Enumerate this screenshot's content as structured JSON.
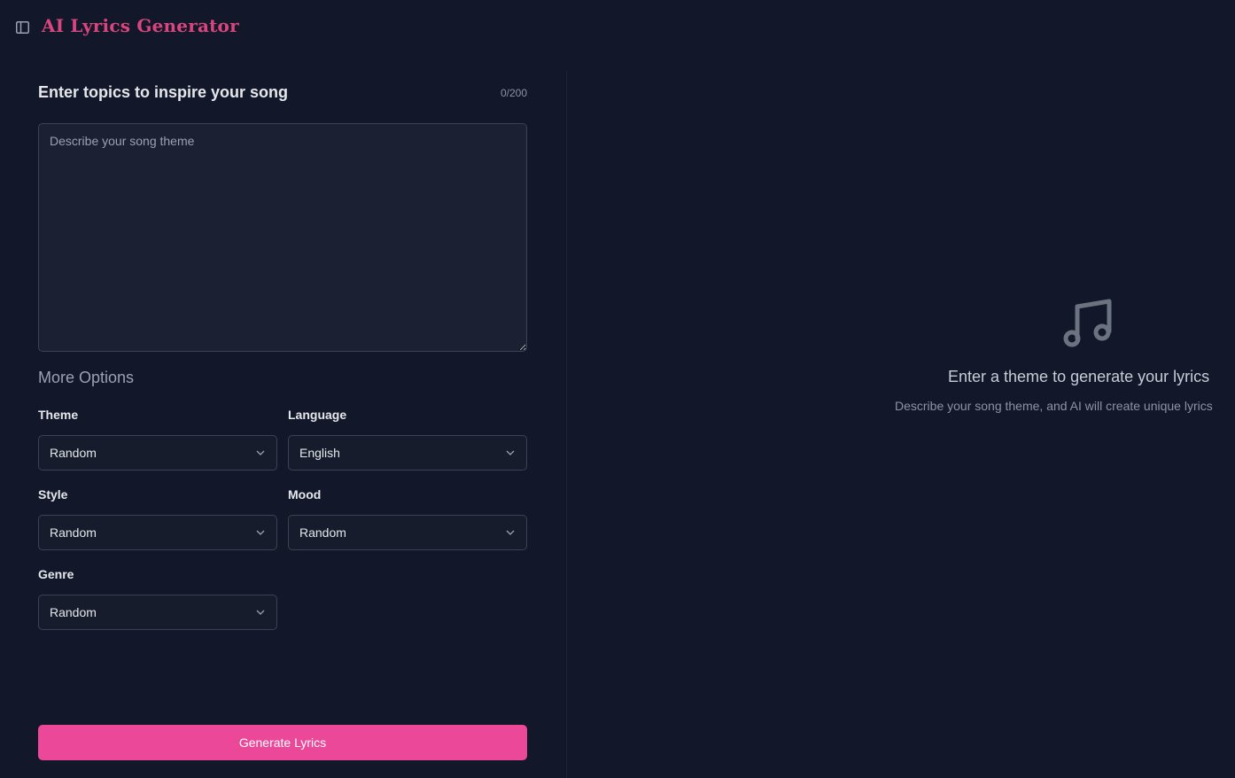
{
  "header": {
    "title": "AI Lyrics Generator",
    "toggle_icon": "sidebar-toggle-icon"
  },
  "prompt": {
    "title": "Enter topics to inspire your song",
    "char_count": "0/200",
    "placeholder": "Describe your song theme",
    "value": ""
  },
  "options": {
    "heading": "More Options",
    "theme": {
      "label": "Theme",
      "value": "Random"
    },
    "language": {
      "label": "Language",
      "value": "English"
    },
    "style": {
      "label": "Style",
      "value": "Random"
    },
    "mood": {
      "label": "Mood",
      "value": "Random"
    },
    "genre": {
      "label": "Genre",
      "value": "Random"
    }
  },
  "actions": {
    "generate_label": "Generate Lyrics",
    "generate_color": "#ec4899"
  },
  "empty_state": {
    "icon": "music-note-icon",
    "title": "Enter a theme to generate your lyrics",
    "description": "Describe your song theme, and AI will create unique lyrics"
  },
  "colors": {
    "background": "#121829",
    "accent_title": "#d9467f"
  }
}
